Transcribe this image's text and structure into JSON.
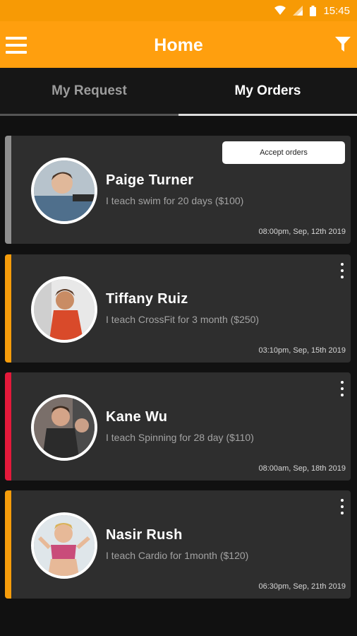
{
  "status_bar": {
    "time": "15:45"
  },
  "header": {
    "title": "Home"
  },
  "tabs": [
    {
      "label": "My Request",
      "active": false
    },
    {
      "label": "My Orders",
      "active": true
    }
  ],
  "orders": [
    {
      "name": "Paige Turner",
      "description": "I teach swim for 20 days ($100)",
      "timestamp": "08:00pm, Sep, 12th 2019",
      "accent_color": "#8f8f8f",
      "action": "Accept orders"
    },
    {
      "name": "Tiffany Ruiz",
      "description": "I teach CrossFit for 3 month ($250)",
      "timestamp": "03:10pm, Sep, 15th 2019",
      "accent_color": "#f59c0b"
    },
    {
      "name": "Kane Wu",
      "description": "I teach Spinning for 28 day ($110)",
      "timestamp": "08:00am, Sep, 18th 2019",
      "accent_color": "#e3193a"
    },
    {
      "name": "Nasir Rush",
      "description": "I teach Cardio for 1month ($120)",
      "timestamp": "06:30pm, Sep, 21th 2019",
      "accent_color": "#f59c0b"
    }
  ],
  "colors": {
    "primary": "#ff9f0e",
    "card_bg": "#2e2e2e",
    "background": "#111111"
  }
}
